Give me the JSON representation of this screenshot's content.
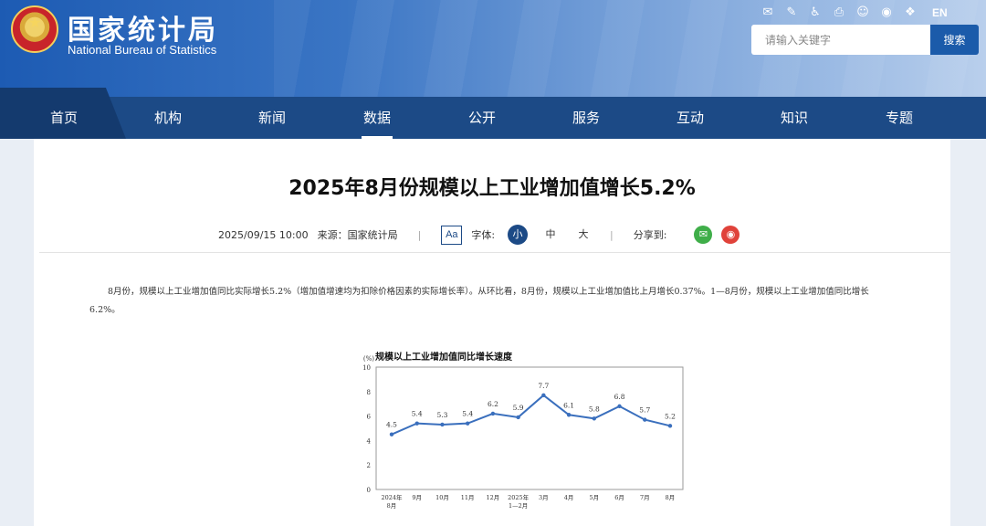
{
  "header": {
    "logo_cn": "国家统计局",
    "logo_en": "National Bureau of Statistics",
    "tools": [
      "mail-icon",
      "feedback-icon",
      "accessibility-icon",
      "print-icon",
      "robot-icon",
      "weibo-icon",
      "wechat-icon"
    ],
    "lang": "EN",
    "search": {
      "placeholder": "请输入关键字",
      "button": "搜索"
    }
  },
  "nav": {
    "items": [
      "首页",
      "机构",
      "新闻",
      "数据",
      "公开",
      "服务",
      "互动",
      "知识",
      "专题"
    ],
    "active": "数据"
  },
  "article": {
    "title": "2025年8月份规模以上工业增加值增长5.2%",
    "datetime": "2025/09/15 10:00",
    "source": "来源：国家统计局",
    "font_icon": "Aa",
    "font_label": "字体:",
    "font_sizes": [
      "小",
      "中",
      "大"
    ],
    "font_active": "小",
    "share_label": "分享到:",
    "share_icons": [
      "wechat-icon",
      "weibo-icon"
    ],
    "paragraph": "8月份，规模以上工业增加值同比实际增长5.2%（增加值增速均为扣除价格因素的实际增长率）。从环比看，8月份，规模以上工业增加值比上月增长0.37%。1—8月份，规模以上工业增加值同比增长6.2%。"
  },
  "colors": {
    "brand": "#1c4a86",
    "accent": "#1b5baa",
    "line": "#3a6fbd",
    "wechat": "#3fae49",
    "weibo": "#e0423a"
  },
  "chart_data": {
    "type": "line",
    "title": "规模以上工业增加值同比增长速度",
    "ylabel": "(%)",
    "ylim": [
      0,
      10
    ],
    "yticks": [
      0,
      2,
      4,
      6,
      8,
      10
    ],
    "grid": false,
    "categories": [
      "2024年8月",
      "9月",
      "10月",
      "11月",
      "12月",
      "2025年1—2月",
      "3月",
      "4月",
      "5月",
      "6月",
      "7月",
      "8月"
    ],
    "category_lines": [
      [
        "2024年",
        "8月"
      ],
      [
        "9月"
      ],
      [
        "10月"
      ],
      [
        "11月"
      ],
      [
        "12月"
      ],
      [
        "2025年",
        "1—2月"
      ],
      [
        "3月"
      ],
      [
        "4月"
      ],
      [
        "5月"
      ],
      [
        "6月"
      ],
      [
        "7月"
      ],
      [
        "8月"
      ]
    ],
    "values": [
      4.5,
      5.4,
      5.3,
      5.4,
      6.2,
      5.9,
      7.7,
      6.1,
      5.8,
      6.8,
      5.7,
      5.2
    ],
    "labels": [
      "4.5",
      "5.4",
      "5.3",
      "5.4",
      "6.2",
      "5.9",
      "7.7",
      "6.1",
      "5.8",
      "6.8",
      "5.7",
      "5.2"
    ]
  }
}
